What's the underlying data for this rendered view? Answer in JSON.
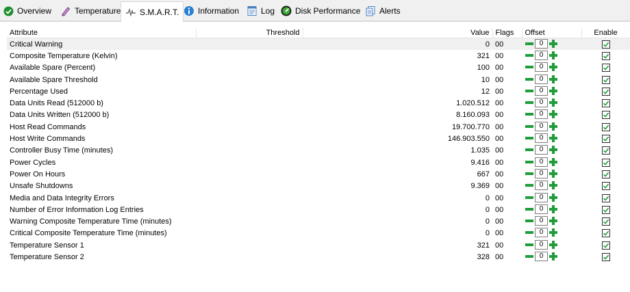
{
  "tabs": [
    {
      "label": "Overview",
      "icon": "check-circle-icon",
      "active": false
    },
    {
      "label": "Temperature",
      "icon": "thermometer-icon",
      "active": false
    },
    {
      "label": "S.M.A.R.T.",
      "icon": "heartbeat-icon",
      "active": true
    },
    {
      "label": "Information",
      "icon": "info-icon",
      "active": false
    },
    {
      "label": "Log",
      "icon": "log-icon",
      "active": false
    },
    {
      "label": "Disk Performance",
      "icon": "speedometer-icon",
      "active": false
    },
    {
      "label": "Alerts",
      "icon": "alerts-icon",
      "active": false
    }
  ],
  "table": {
    "columns": [
      "Attribute",
      "Threshold",
      "Value",
      "Flags",
      "Offset",
      "Enable"
    ],
    "rows": [
      {
        "attribute": "Critical Warning",
        "value": "0",
        "flags": "00",
        "offset": "0",
        "enabled": true
      },
      {
        "attribute": "Composite Temperature (Kelvin)",
        "value": "321",
        "flags": "00",
        "offset": "0",
        "enabled": true
      },
      {
        "attribute": "Available Spare (Percent)",
        "value": "100",
        "flags": "00",
        "offset": "0",
        "enabled": true
      },
      {
        "attribute": "Available Spare Threshold",
        "value": "10",
        "flags": "00",
        "offset": "0",
        "enabled": true
      },
      {
        "attribute": "Percentage Used",
        "value": "12",
        "flags": "00",
        "offset": "0",
        "enabled": true
      },
      {
        "attribute": "Data Units Read (512000 b)",
        "value": "1.020.512",
        "flags": "00",
        "offset": "0",
        "enabled": true
      },
      {
        "attribute": "Data Units Written (512000 b)",
        "value": "8.160.093",
        "flags": "00",
        "offset": "0",
        "enabled": true
      },
      {
        "attribute": "Host Read Commands",
        "value": "19.700.770",
        "flags": "00",
        "offset": "0",
        "enabled": true
      },
      {
        "attribute": "Host Write Commands",
        "value": "146.903.550",
        "flags": "00",
        "offset": "0",
        "enabled": true
      },
      {
        "attribute": "Controller Busy Time (minutes)",
        "value": "1.035",
        "flags": "00",
        "offset": "0",
        "enabled": true
      },
      {
        "attribute": "Power Cycles",
        "value": "9.416",
        "flags": "00",
        "offset": "0",
        "enabled": true
      },
      {
        "attribute": "Power On Hours",
        "value": "667",
        "flags": "00",
        "offset": "0",
        "enabled": true
      },
      {
        "attribute": "Unsafe Shutdowns",
        "value": "9.369",
        "flags": "00",
        "offset": "0",
        "enabled": true
      },
      {
        "attribute": "Media and Data Integrity Errors",
        "value": "0",
        "flags": "00",
        "offset": "0",
        "enabled": true
      },
      {
        "attribute": "Number of Error Information Log Entries",
        "value": "0",
        "flags": "00",
        "offset": "0",
        "enabled": true
      },
      {
        "attribute": "Warning Composite Temperature Time (minutes)",
        "value": "0",
        "flags": "00",
        "offset": "0",
        "enabled": true
      },
      {
        "attribute": "Critical Composite Temperature Time (minutes)",
        "value": "0",
        "flags": "00",
        "offset": "0",
        "enabled": true
      },
      {
        "attribute": "Temperature Sensor 1",
        "value": "321",
        "flags": "00",
        "offset": "0",
        "enabled": true
      },
      {
        "attribute": "Temperature Sensor 2",
        "value": "328",
        "flags": "00",
        "offset": "0",
        "enabled": true
      }
    ]
  },
  "colors": {
    "offset_buttons": "#1f9d3a",
    "checkbox_tick": "#1f9d3a",
    "selected_row": "#f0f0f0"
  }
}
